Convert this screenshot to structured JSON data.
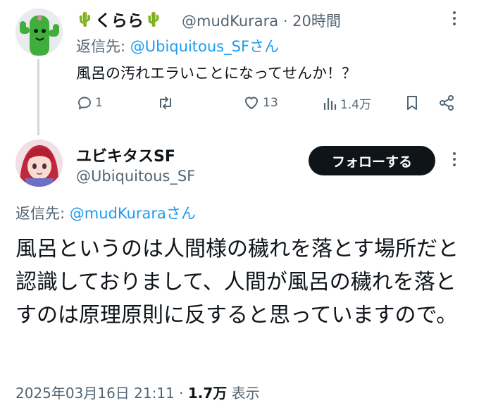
{
  "reply_tweet": {
    "display_name": "くらら",
    "name_emoji_left": "🌵",
    "name_emoji_right": "🌵",
    "handle": "@mudKurara",
    "time": "· 20時間",
    "reply_to_prefix": "返信先: ",
    "reply_to_mention": "@Ubiquitous_SF",
    "reply_to_suffix": "さん",
    "text": "風呂の汚れエラいことになってせんか！？",
    "actions": {
      "reply_count": "1",
      "retweet_count": "",
      "like_count": "13",
      "view_count": "1.4万"
    }
  },
  "main_tweet": {
    "display_name": "ユビキタスSF",
    "handle": "@Ubiquitous_SF",
    "follow_label": "フォローする",
    "reply_to_prefix": "返信先: ",
    "reply_to_mention": "@mudKurara",
    "reply_to_suffix": "さん",
    "text": "風呂というのは人間様の穢れを落とす場所だと認識しておりまして、人間が風呂の穢れを落とすのは原理原則に反すると思っていますので。",
    "timestamp": "2025年03月16日 21:11 · ",
    "views_count": "1.7万",
    "views_label": " 表示"
  },
  "icons": {
    "reply": "reply-icon",
    "retweet": "retweet-icon",
    "like": "heart-icon",
    "views": "views-chart-icon",
    "bookmark": "bookmark-icon",
    "share": "share-icon",
    "more": "more-vertical-icon"
  },
  "colors": {
    "link": "#1d9bf0",
    "secondary_text": "#536471",
    "follow_button_bg": "#0f1419"
  }
}
